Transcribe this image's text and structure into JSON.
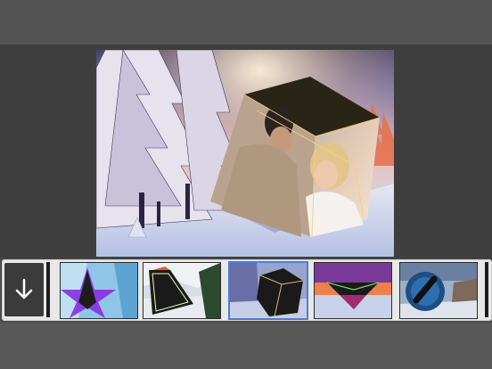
{
  "app": {
    "accent_color": "#4a7fd6",
    "background_color": "#575757"
  },
  "toolbar": {
    "download_icon": "arrow-down-icon"
  },
  "preview": {
    "subject": "couple-in-3d-cube-frame",
    "frame_style": "3D cube"
  },
  "frames": [
    {
      "name": "star-frame",
      "selected": false
    },
    {
      "name": "triangle-frame",
      "selected": false
    },
    {
      "name": "cube-frame",
      "selected": true
    },
    {
      "name": "diamond-frame",
      "selected": false
    },
    {
      "name": "circle-frame",
      "selected": false
    }
  ]
}
